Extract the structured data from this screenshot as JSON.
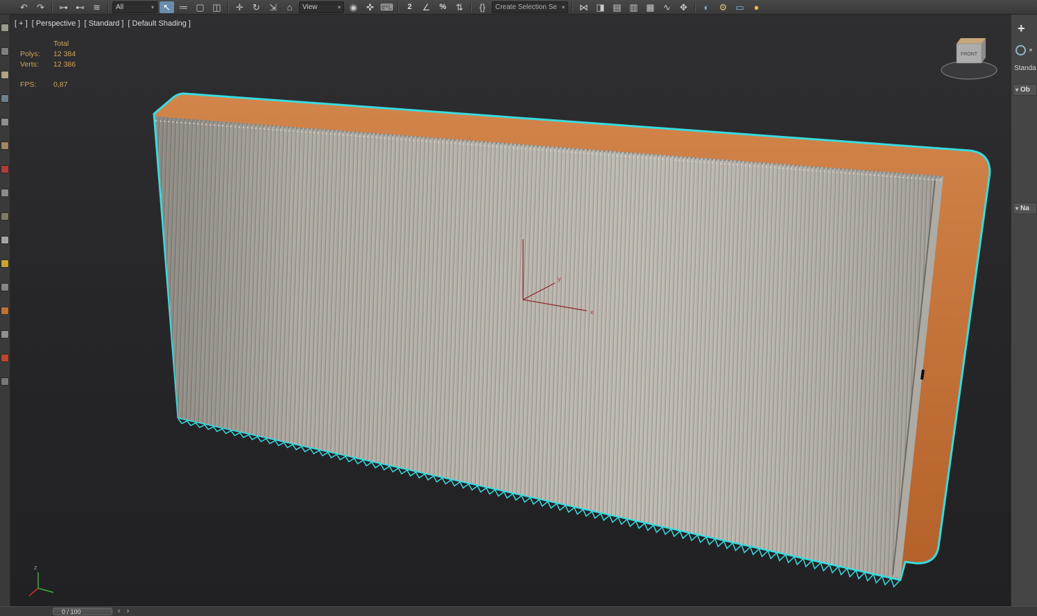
{
  "colors": {
    "selection_cyan": "#39dbe0",
    "frame_orange_light": "#d2854a",
    "frame_orange_dark": "#b4602a",
    "pleat_light": "#b7b4ad",
    "pleat_dark": "#93908a",
    "pleat_mid": "#c6c3bc",
    "stats_text": "#cfa55a"
  },
  "toolbar": {
    "items": [
      {
        "type": "icon",
        "name": "undo-icon",
        "glyph": "↶"
      },
      {
        "type": "icon",
        "name": "redo-icon",
        "glyph": "↷"
      },
      {
        "type": "separator"
      },
      {
        "type": "icon",
        "name": "select-and-link-icon",
        "glyph": "⊶"
      },
      {
        "type": "icon",
        "name": "unlink-selection-icon",
        "glyph": "⊷"
      },
      {
        "type": "icon",
        "name": "bind-to-space-warp-icon",
        "glyph": "≋"
      },
      {
        "type": "separator"
      },
      {
        "type": "dropdown",
        "name": "selection-filter-dropdown",
        "value": "All"
      },
      {
        "type": "icon",
        "name": "select-object-icon",
        "glyph": "↖",
        "active": true
      },
      {
        "type": "icon",
        "name": "select-by-name-icon",
        "glyph": "≔"
      },
      {
        "type": "icon",
        "name": "rectangular-selection-region-icon",
        "glyph": "▢"
      },
      {
        "type": "icon",
        "name": "window-crossing-icon",
        "glyph": "◫"
      },
      {
        "type": "separator"
      },
      {
        "type": "icon",
        "name": "select-and-move-icon",
        "glyph": "✛"
      },
      {
        "type": "icon",
        "name": "select-and-rotate-icon",
        "glyph": "↻"
      },
      {
        "type": "icon",
        "name": "select-and-scale-icon",
        "glyph": "⇲"
      },
      {
        "type": "icon",
        "name": "select-and-place-icon",
        "glyph": "⌂"
      },
      {
        "type": "dropdown",
        "name": "reference-coordinate-dropdown",
        "value": "View"
      },
      {
        "type": "icon",
        "name": "use-pivot-point-icon",
        "glyph": "◉"
      },
      {
        "type": "icon",
        "name": "select-and-manipulate-icon",
        "glyph": "✜"
      },
      {
        "type": "icon",
        "name": "keyboard-shortcut-override-icon",
        "glyph": "⌨"
      },
      {
        "type": "separator"
      },
      {
        "type": "icon",
        "name": "snaps-toggle-icon",
        "glyph": "2",
        "text_style": true
      },
      {
        "type": "icon",
        "name": "angle-snap-icon",
        "glyph": "∠"
      },
      {
        "type": "icon",
        "name": "percent-snap-icon",
        "glyph": "%",
        "text_style": true
      },
      {
        "type": "icon",
        "name": "spinner-snap-icon",
        "glyph": "⇅"
      },
      {
        "type": "separator"
      },
      {
        "type": "icon",
        "name": "edit-named-selection-sets-icon",
        "glyph": "{}"
      },
      {
        "type": "field",
        "name": "named-selection-set-field",
        "value": "Create Selection Se"
      },
      {
        "type": "separator"
      },
      {
        "type": "icon",
        "name": "mirror-icon",
        "glyph": "⋈"
      },
      {
        "type": "icon",
        "name": "align-icon",
        "glyph": "◨"
      },
      {
        "type": "icon",
        "name": "toggle-scene-explorer-icon",
        "glyph": "▤"
      },
      {
        "type": "icon",
        "name": "toggle-layer-explorer-icon",
        "glyph": "▥"
      },
      {
        "type": "icon",
        "name": "toggle-ribbon-icon",
        "glyph": "▦"
      },
      {
        "type": "icon",
        "name": "curve-editor-icon",
        "glyph": "∿"
      },
      {
        "type": "icon",
        "name": "schematic-view-icon",
        "glyph": "✥"
      },
      {
        "type": "separator"
      },
      {
        "type": "icon",
        "name": "material-editor-icon",
        "glyph": "◐",
        "color": "#86b7d7"
      },
      {
        "type": "icon",
        "name": "render-setup-icon",
        "glyph": "⚙",
        "color": "#d2c270"
      },
      {
        "type": "icon",
        "name": "rendered-frame-window-icon",
        "glyph": "▭",
        "color": "#86b7d7"
      },
      {
        "type": "icon",
        "name": "render-production-icon",
        "glyph": "●",
        "color": "#e8b84a"
      }
    ]
  },
  "left_toolbar": {
    "icons": [
      {
        "name": "left-toolbar-icon-1",
        "color": "#9a9a8e"
      },
      {
        "name": "left-toolbar-icon-2",
        "color": "#7f7f7f"
      },
      {
        "name": "left-toolbar-icon-3",
        "color": "#b3a183"
      },
      {
        "name": "left-toolbar-icon-4",
        "color": "#6f7f8c"
      },
      {
        "name": "left-toolbar-icon-5",
        "color": "#8f8f8f"
      },
      {
        "name": "left-toolbar-icon-6",
        "color": "#a08663"
      },
      {
        "name": "left-toolbar-icon-7",
        "color": "#b23b3b"
      },
      {
        "name": "left-toolbar-icon-8",
        "color": "#8c8c8c"
      },
      {
        "name": "left-toolbar-icon-9",
        "color": "#7f7a66"
      },
      {
        "name": "left-toolbar-icon-10",
        "color": "#a3a3a3"
      },
      {
        "name": "left-toolbar-icon-11",
        "color": "#caa32f"
      },
      {
        "name": "left-toolbar-icon-12",
        "color": "#868686"
      },
      {
        "name": "left-toolbar-icon-13",
        "color": "#bb7233"
      },
      {
        "name": "left-toolbar-icon-14",
        "color": "#909090"
      },
      {
        "name": "left-toolbar-icon-15",
        "color": "#c24532"
      },
      {
        "name": "left-toolbar-icon-16",
        "color": "#777777"
      }
    ]
  },
  "viewport": {
    "label": {
      "general": "[ + ]",
      "pov": "[ Perspective ]",
      "style": "[ Standard ]",
      "shading": "[ Default Shading ]"
    },
    "stats": {
      "total_header": "Total",
      "polys_label": "Polys:",
      "polys_value": "12 384",
      "verts_label": "Verts:",
      "verts_value": "12 386",
      "fps_label": "FPS:",
      "fps_value": "0,87"
    },
    "axis_tripod": {
      "x": "x",
      "y": "y",
      "z": "z"
    },
    "world_axis": {
      "z": "z"
    },
    "viewcube": {
      "front": "FRONT"
    }
  },
  "command_panel": {
    "create_label": "+",
    "category_label": "Standa",
    "rollouts": [
      {
        "arrow": "▾",
        "label": "Ob"
      },
      {
        "arrow": "▾",
        "label": "Na"
      }
    ]
  },
  "timeline": {
    "frame_display": "0 / 100",
    "prev": "‹",
    "next": "›"
  }
}
